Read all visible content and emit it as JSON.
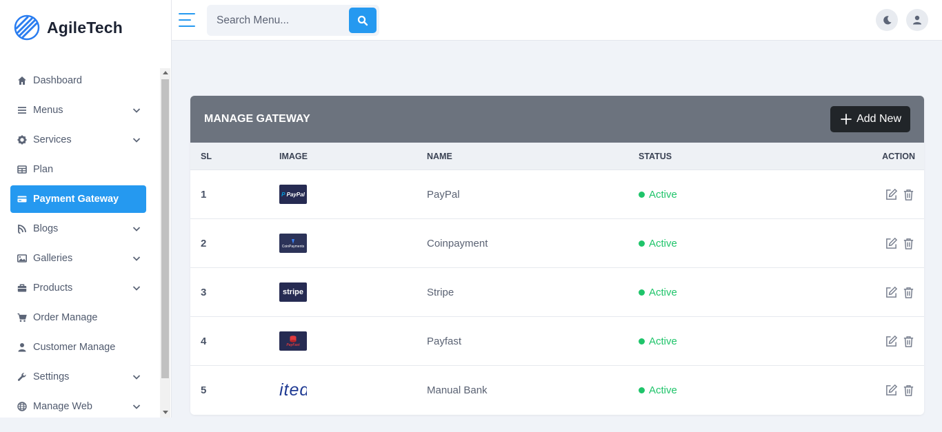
{
  "brand": {
    "name": "AgileTech"
  },
  "search": {
    "placeholder": "Search Menu..."
  },
  "sidebar": {
    "items": [
      {
        "label": "Dashboard",
        "icon": "home-icon",
        "has_sub": false,
        "active": false
      },
      {
        "label": "Menus",
        "icon": "list-icon",
        "has_sub": true,
        "active": false
      },
      {
        "label": "Services",
        "icon": "gear-icon",
        "has_sub": true,
        "active": false
      },
      {
        "label": "Plan",
        "icon": "table-icon",
        "has_sub": false,
        "active": false
      },
      {
        "label": "Payment Gateway",
        "icon": "credit-card-icon",
        "has_sub": false,
        "active": true
      },
      {
        "label": "Blogs",
        "icon": "blog-icon",
        "has_sub": true,
        "active": false
      },
      {
        "label": "Galleries",
        "icon": "image-icon",
        "has_sub": true,
        "active": false
      },
      {
        "label": "Products",
        "icon": "briefcase-icon",
        "has_sub": true,
        "active": false
      },
      {
        "label": "Order Manage",
        "icon": "cart-icon",
        "has_sub": false,
        "active": false
      },
      {
        "label": "Customer Manage",
        "icon": "user-icon",
        "has_sub": false,
        "active": false
      },
      {
        "label": "Settings",
        "icon": "wrench-icon",
        "has_sub": true,
        "active": false
      },
      {
        "label": "Manage Web",
        "icon": "globe-icon",
        "has_sub": true,
        "active": false
      }
    ]
  },
  "card": {
    "title": "MANAGE GATEWAY",
    "add_label": "Add New",
    "columns": {
      "sl": "SL",
      "image": "IMAGE",
      "name": "NAME",
      "status": "STATUS",
      "action": "ACTION"
    },
    "rows": [
      {
        "sl": "1",
        "name": "PayPal",
        "logo_text": "PayPal",
        "status": "Active"
      },
      {
        "sl": "2",
        "name": "Coinpayment",
        "logo_text": "CoinPayments",
        "status": "Active"
      },
      {
        "sl": "3",
        "name": "Stripe",
        "logo_text": "stripe",
        "status": "Active"
      },
      {
        "sl": "4",
        "name": "Payfast",
        "logo_text": "PayFast",
        "status": "Active"
      },
      {
        "sl": "5",
        "name": "Manual Bank",
        "logo_text": "ited",
        "status": "Active"
      }
    ]
  },
  "colors": {
    "accent": "#2599f0",
    "header_bg": "#6c737e",
    "status_active": "#1fc46a"
  }
}
